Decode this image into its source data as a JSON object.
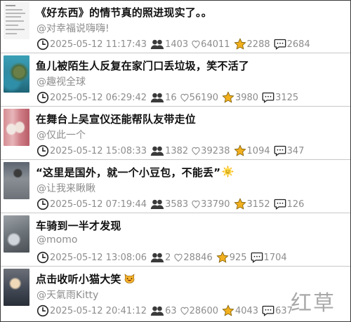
{
  "feed": {
    "items": [
      {
        "title": "《好东西》的情节真的照进现实了。。",
        "author": "@对幸福说嗨嗨!",
        "date": "2025-05-12 11:17:43",
        "plays": "1403",
        "likes": "64011",
        "favorites": "2288",
        "comments": "2684",
        "thumb": "document"
      },
      {
        "title": "鱼儿被陌生人反复在家门口丢垃圾，笑不活了",
        "author": "@趣视全球",
        "date": "2025-05-12 06:29:42",
        "plays": "16",
        "likes": "56190",
        "favorites": "3980",
        "comments": "3125",
        "thumb": "turtle"
      },
      {
        "title": "在舞台上吴宣仪还能帮队友带走位",
        "author": "@仅此一个",
        "date": "2025-05-12 15:08:33",
        "plays": "1382",
        "likes": "39238",
        "favorites": "1094",
        "comments": "347",
        "thumb": "stage"
      },
      {
        "title": "“这里是国外，就一个小豆包，不能丢”",
        "author": "@让我来瞅瞅",
        "date": "2025-05-12 07:19:44",
        "plays": "3583",
        "likes": "33790",
        "favorites": "3152",
        "comments": "126",
        "thumb": "street",
        "emoji": "sun-face-emoji"
      },
      {
        "title": "车骑到一半才发现",
        "author": "@momo",
        "date": "2025-05-12 13:08:06",
        "plays": "2",
        "likes": "28846",
        "favorites": "925",
        "comments": "1704",
        "thumb": "bike"
      },
      {
        "title": "点击收听小猫大笑",
        "author": "@天氣雨Kitty",
        "date": "2025-05-12 20:41:12",
        "plays": "63",
        "likes": "28600",
        "favorites": "4043",
        "comments": "637",
        "thumb": "cat",
        "emoji": "cat-face-emoji"
      }
    ]
  },
  "watermark": {
    "text": "红草"
  },
  "colors": {
    "meta_text": "#8d8d8d",
    "title_text": "#111111",
    "star": "#f2b01e",
    "divider": "#c8c8c8"
  }
}
